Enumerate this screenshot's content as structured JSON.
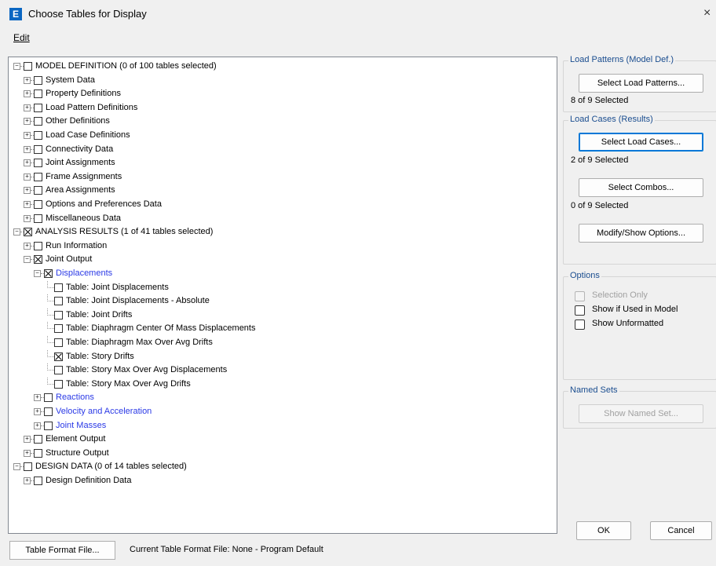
{
  "window": {
    "title": "Choose Tables for Display",
    "icon_letter": "E",
    "close_glyph": "×"
  },
  "menu": {
    "edit_label": "Edit"
  },
  "tree": [
    {
      "label": "MODEL DEFINITION  (0 of 100 tables selected)",
      "level": 0,
      "expander": "-",
      "checked": false,
      "blue": false
    },
    {
      "label": "System Data",
      "level": 1,
      "expander": "+",
      "checked": false,
      "blue": false
    },
    {
      "label": "Property Definitions",
      "level": 1,
      "expander": "+",
      "checked": false,
      "blue": false
    },
    {
      "label": "Load Pattern Definitions",
      "level": 1,
      "expander": "+",
      "checked": false,
      "blue": false
    },
    {
      "label": "Other Definitions",
      "level": 1,
      "expander": "+",
      "checked": false,
      "blue": false
    },
    {
      "label": "Load Case Definitions",
      "level": 1,
      "expander": "+",
      "checked": false,
      "blue": false
    },
    {
      "label": "Connectivity Data",
      "level": 1,
      "expander": "+",
      "checked": false,
      "blue": false
    },
    {
      "label": "Joint Assignments",
      "level": 1,
      "expander": "+",
      "checked": false,
      "blue": false
    },
    {
      "label": "Frame Assignments",
      "level": 1,
      "expander": "+",
      "checked": false,
      "blue": false
    },
    {
      "label": "Area Assignments",
      "level": 1,
      "expander": "+",
      "checked": false,
      "blue": false
    },
    {
      "label": "Options and Preferences Data",
      "level": 1,
      "expander": "+",
      "checked": false,
      "blue": false
    },
    {
      "label": "Miscellaneous Data",
      "level": 1,
      "expander": "+",
      "checked": false,
      "blue": false
    },
    {
      "label": "ANALYSIS RESULTS  (1 of 41 tables selected)",
      "level": 0,
      "expander": "-",
      "checked": true,
      "blue": false
    },
    {
      "label": "Run Information",
      "level": 1,
      "expander": "+",
      "checked": false,
      "blue": false
    },
    {
      "label": "Joint Output",
      "level": 1,
      "expander": "-",
      "checked": true,
      "blue": false
    },
    {
      "label": "Displacements",
      "level": 2,
      "expander": "-",
      "checked": true,
      "blue": true
    },
    {
      "label": "Table:  Joint Displacements",
      "level": 3,
      "expander": "",
      "checked": false,
      "blue": false
    },
    {
      "label": "Table:  Joint Displacements - Absolute",
      "level": 3,
      "expander": "",
      "checked": false,
      "blue": false
    },
    {
      "label": "Table:  Joint Drifts",
      "level": 3,
      "expander": "",
      "checked": false,
      "blue": false
    },
    {
      "label": "Table:  Diaphragm Center Of Mass Displacements",
      "level": 3,
      "expander": "",
      "checked": false,
      "blue": false
    },
    {
      "label": "Table:  Diaphragm Max Over Avg Drifts",
      "level": 3,
      "expander": "",
      "checked": false,
      "blue": false
    },
    {
      "label": "Table:  Story Drifts",
      "level": 3,
      "expander": "",
      "checked": true,
      "blue": false
    },
    {
      "label": "Table:  Story Max Over Avg Displacements",
      "level": 3,
      "expander": "",
      "checked": false,
      "blue": false
    },
    {
      "label": "Table:  Story Max Over Avg Drifts",
      "level": 3,
      "expander": "",
      "checked": false,
      "blue": false
    },
    {
      "label": "Reactions",
      "level": 2,
      "expander": "+",
      "checked": false,
      "blue": true
    },
    {
      "label": "Velocity and Acceleration",
      "level": 2,
      "expander": "+",
      "checked": false,
      "blue": true
    },
    {
      "label": "Joint Masses",
      "level": 2,
      "expander": "+",
      "checked": false,
      "blue": true
    },
    {
      "label": "Element Output",
      "level": 1,
      "expander": "+",
      "checked": false,
      "blue": false
    },
    {
      "label": "Structure Output",
      "level": 1,
      "expander": "+",
      "checked": false,
      "blue": false
    },
    {
      "label": "DESIGN DATA  (0 of 14 tables selected)",
      "level": 0,
      "expander": "-",
      "checked": false,
      "blue": false
    },
    {
      "label": "Design Definition Data",
      "level": 1,
      "expander": "+",
      "checked": false,
      "blue": false
    }
  ],
  "load_patterns": {
    "title": "Load Patterns (Model Def.)",
    "button": "Select Load Patterns...",
    "status": "8 of 9 Selected"
  },
  "load_cases": {
    "title": "Load Cases (Results)",
    "cases_button": "Select Load Cases...",
    "cases_status": "2 of 9 Selected",
    "combos_button": "Select Combos...",
    "combos_status": "0 of 9 Selected",
    "modify_button": "Modify/Show Options..."
  },
  "options": {
    "title": "Options",
    "items": [
      {
        "label": "Selection Only",
        "checked": false,
        "disabled": true
      },
      {
        "label": "Show if Used in Model",
        "checked": false,
        "disabled": false
      },
      {
        "label": "Show Unformatted",
        "checked": false,
        "disabled": false
      }
    ]
  },
  "named_sets": {
    "title": "Named Sets",
    "button": "Show Named Set..."
  },
  "dialog_buttons": {
    "ok": "OK",
    "cancel": "Cancel"
  },
  "footer": {
    "format_file_button": "Table Format File...",
    "current_file_text": "Current Table Format File:  None - Program Default"
  },
  "colors": {
    "link_blue": "#2a39e6",
    "group_title": "#1a4d8f",
    "focus_blue": "#0078d7"
  }
}
